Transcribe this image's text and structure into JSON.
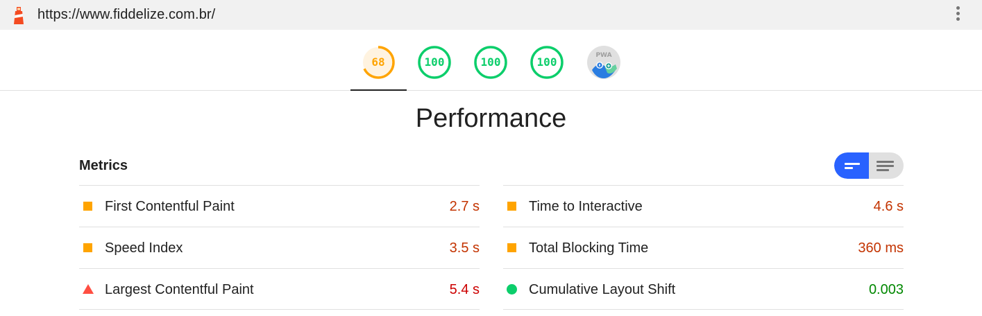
{
  "topbar": {
    "url": "https://www.fiddelize.com.br/",
    "logo_icon": "lighthouse-icon",
    "menu_icon": "kebab-menu-icon"
  },
  "gauges": [
    {
      "label": "68",
      "score": 0.68,
      "color": "#ffa400",
      "bg": "#fff3e0"
    },
    {
      "label": "100",
      "score": 1.0,
      "color": "#0cce6b",
      "bg": "#ffffff"
    },
    {
      "label": "100",
      "score": 1.0,
      "color": "#0cce6b",
      "bg": "#ffffff"
    },
    {
      "label": "100",
      "score": 1.0,
      "color": "#0cce6b",
      "bg": "#ffffff"
    },
    {
      "label": "PWA",
      "icon": "pwa-badge-icon"
    }
  ],
  "section": {
    "title": "Performance",
    "metrics_label": "Metrics"
  },
  "metrics": {
    "left": [
      {
        "name": "First Contentful Paint",
        "value": "2.7 s",
        "status": "average"
      },
      {
        "name": "Speed Index",
        "value": "3.5 s",
        "status": "average"
      },
      {
        "name": "Largest Contentful Paint",
        "value": "5.4 s",
        "status": "fail"
      }
    ],
    "right": [
      {
        "name": "Time to Interactive",
        "value": "4.6 s",
        "status": "average"
      },
      {
        "name": "Total Blocking Time",
        "value": "360 ms",
        "status": "average"
      },
      {
        "name": "Cumulative Layout Shift",
        "value": "0.003",
        "status": "pass"
      }
    ]
  },
  "colors": {
    "average": "#ffa400",
    "fail": "#ff4e42",
    "pass": "#0cce6b",
    "toggle_active": "#2962ff"
  }
}
